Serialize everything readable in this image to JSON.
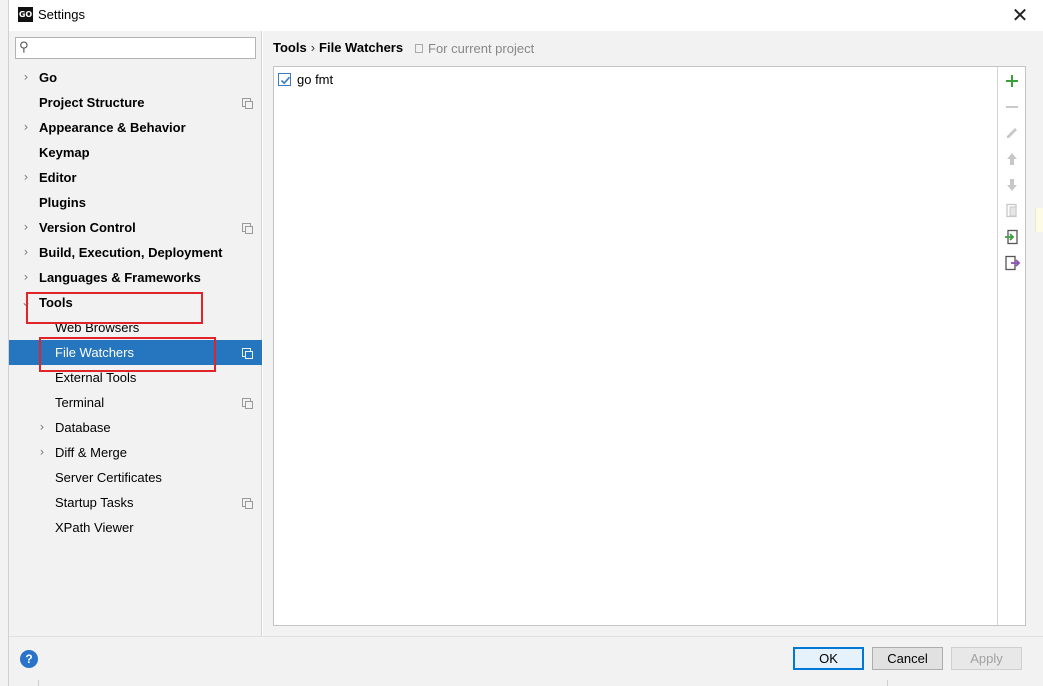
{
  "window": {
    "title": "Settings",
    "app_icon": "GO"
  },
  "search": {
    "placeholder": ""
  },
  "sidebar": {
    "items": [
      {
        "label": "Go",
        "arrow": "›",
        "bold": true,
        "indent": 0,
        "project_icon": false
      },
      {
        "label": "Project Structure",
        "arrow": "",
        "bold": true,
        "indent": 0,
        "project_icon": true
      },
      {
        "label": "Appearance & Behavior",
        "arrow": "›",
        "bold": true,
        "indent": 0,
        "project_icon": false
      },
      {
        "label": "Keymap",
        "arrow": "",
        "bold": true,
        "indent": 0,
        "project_icon": false
      },
      {
        "label": "Editor",
        "arrow": "›",
        "bold": true,
        "indent": 0,
        "project_icon": false
      },
      {
        "label": "Plugins",
        "arrow": "",
        "bold": true,
        "indent": 0,
        "project_icon": false
      },
      {
        "label": "Version Control",
        "arrow": "›",
        "bold": true,
        "indent": 0,
        "project_icon": true
      },
      {
        "label": "Build, Execution, Deployment",
        "arrow": "›",
        "bold": true,
        "indent": 0,
        "project_icon": false
      },
      {
        "label": "Languages & Frameworks",
        "arrow": "›",
        "bold": true,
        "indent": 0,
        "project_icon": false
      },
      {
        "label": "Tools",
        "arrow": "⌄",
        "bold": true,
        "indent": 0,
        "project_icon": false
      },
      {
        "label": "Web Browsers",
        "arrow": "",
        "bold": false,
        "indent": 1,
        "project_icon": false
      },
      {
        "label": "File Watchers",
        "arrow": "",
        "bold": false,
        "indent": 1,
        "project_icon": true,
        "selected": true
      },
      {
        "label": "External Tools",
        "arrow": "",
        "bold": false,
        "indent": 1,
        "project_icon": false
      },
      {
        "label": "Terminal",
        "arrow": "",
        "bold": false,
        "indent": 1,
        "project_icon": true
      },
      {
        "label": "Database",
        "arrow": "›",
        "bold": false,
        "indent": 1,
        "project_icon": false
      },
      {
        "label": "Diff & Merge",
        "arrow": "›",
        "bold": false,
        "indent": 1,
        "project_icon": false
      },
      {
        "label": "Server Certificates",
        "arrow": "",
        "bold": false,
        "indent": 1,
        "project_icon": false
      },
      {
        "label": "Startup Tasks",
        "arrow": "",
        "bold": false,
        "indent": 1,
        "project_icon": true
      },
      {
        "label": "XPath Viewer",
        "arrow": "",
        "bold": false,
        "indent": 1,
        "project_icon": false
      }
    ]
  },
  "breadcrumb": {
    "parent": "Tools",
    "separator": "›",
    "current": "File Watchers",
    "scope": "For current project"
  },
  "watchers": [
    {
      "name": "go fmt",
      "checked": true
    }
  ],
  "toolbar": {
    "icons": [
      "add-icon",
      "remove-icon",
      "edit-icon",
      "move-up-icon",
      "move-down-icon",
      "copy-icon",
      "import-icon",
      "export-icon"
    ]
  },
  "footer": {
    "help": "?",
    "ok_label": "OK",
    "cancel_label": "Cancel",
    "apply_label": "Apply"
  },
  "colors": {
    "selection": "#2675bf",
    "annotation_red": "#e0242a",
    "add_green": "#3aa03a"
  }
}
